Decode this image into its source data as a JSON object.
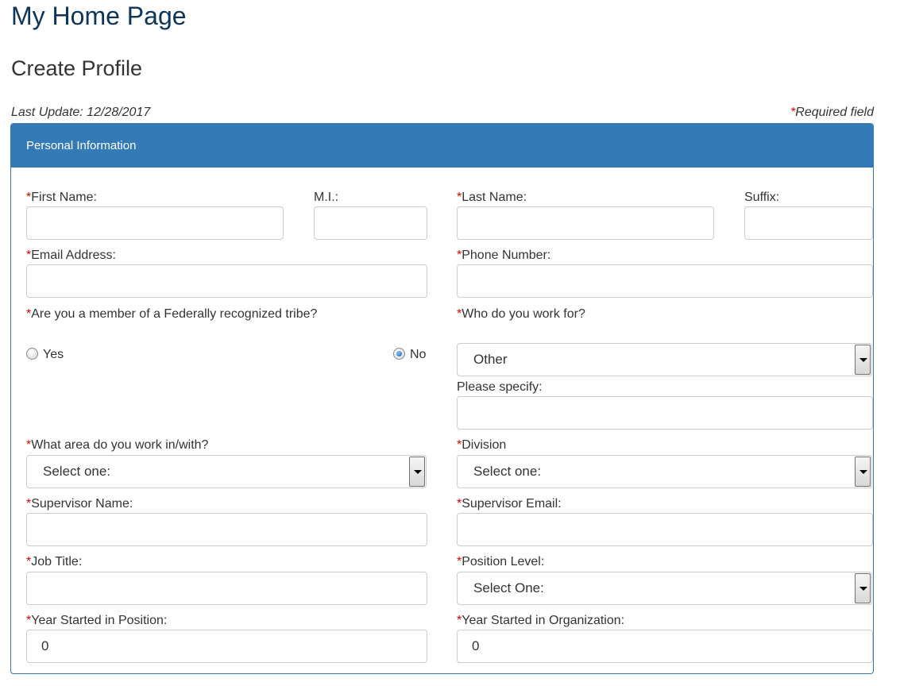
{
  "header": {
    "page_title": "My Home Page",
    "section_title": "Create Profile",
    "last_update": "Last Update: 12/28/2017",
    "required_asterisk": "*",
    "required_note": "Required field"
  },
  "panel": {
    "heading": "Personal Information"
  },
  "form": {
    "asterisk": "*",
    "first_name": {
      "label": "First Name:",
      "value": ""
    },
    "mi": {
      "label": "M.I.:",
      "value": ""
    },
    "last_name": {
      "label": "Last Name:",
      "value": ""
    },
    "suffix": {
      "label": "Suffix:",
      "value": ""
    },
    "email": {
      "label": "Email Address:",
      "value": ""
    },
    "phone": {
      "label": "Phone Number:",
      "value": ""
    },
    "tribe": {
      "label": "Are you a member of a Federally recognized tribe?",
      "options": [
        {
          "label": "Yes",
          "checked": false
        },
        {
          "label": "No",
          "checked": true
        }
      ]
    },
    "employer": {
      "label": "Who do you work for?",
      "selected": "Other"
    },
    "please_specify": {
      "label": "Please specify:",
      "value": ""
    },
    "work_area": {
      "label": "What area do you work in/with?",
      "selected": "Select one:"
    },
    "division": {
      "label": "Division",
      "selected": "Select one:"
    },
    "supervisor_name": {
      "label": "Supervisor Name:",
      "value": ""
    },
    "supervisor_email": {
      "label": "Supervisor Email:",
      "value": ""
    },
    "job_title": {
      "label": "Job Title:",
      "value": ""
    },
    "position_level": {
      "label": "Position Level:",
      "selected": "Select One:"
    },
    "year_position": {
      "label": "Year Started in Position:",
      "value": "0"
    },
    "year_org": {
      "label": "Year Started in Organization:",
      "value": "0"
    }
  }
}
